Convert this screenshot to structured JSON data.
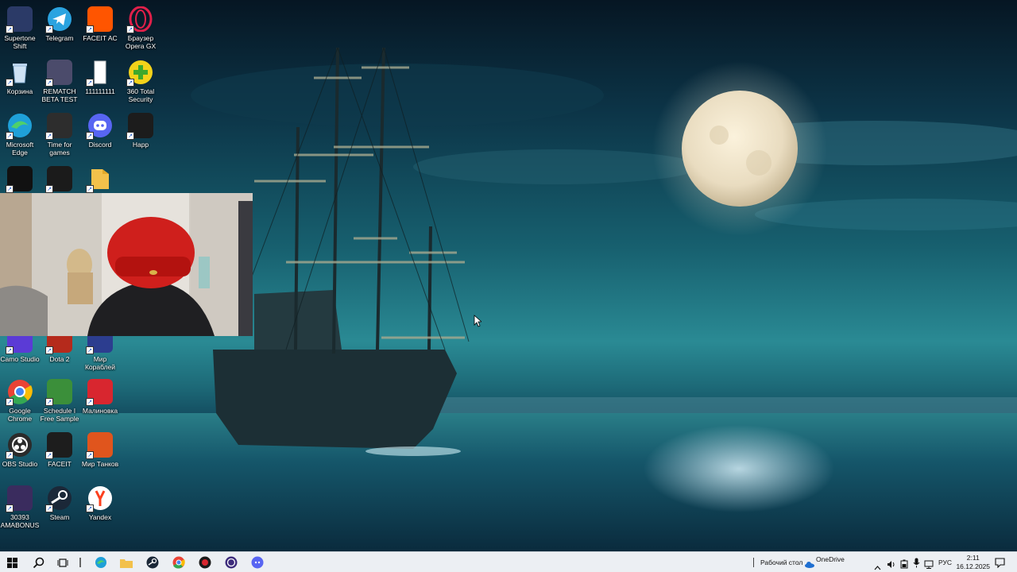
{
  "desktop": {
    "icons": [
      {
        "label": "Supertone Shift",
        "icon": "supertone-icon",
        "color": "#2b3a67"
      },
      {
        "label": "Telegram",
        "icon": "telegram-icon",
        "color": "#2aa3e0"
      },
      {
        "label": "FACEIT AC",
        "icon": "faceit-ac-icon",
        "color": "#ff5500"
      },
      {
        "label": "Браузер Opera GX",
        "icon": "opera-gx-icon",
        "color": "#e1204a"
      },
      {
        "label": "Корзина",
        "icon": "recycle-bin-icon",
        "color": "#9ec6e8"
      },
      {
        "label": "REMATCH BETA TEST",
        "icon": "rematch-icon",
        "color": "#4b4b6b"
      },
      {
        "label": "111111111",
        "icon": "blank-file-icon",
        "color": "#ffffff"
      },
      {
        "label": "360 Total Security",
        "icon": "360-security-icon",
        "color": "#5bbd2b"
      },
      {
        "label": "Microsoft Edge",
        "icon": "edge-icon",
        "color": "#1fa0d8"
      },
      {
        "label": "Time for games",
        "icon": "gamepad-icon",
        "color": "#2d2d2d"
      },
      {
        "label": "Discord",
        "icon": "discord-icon",
        "color": "#5865f2"
      },
      {
        "label": "Happ",
        "icon": "happ-icon",
        "color": "#1c1c1c"
      },
      {
        "label": "",
        "icon": "logitech-g-icon",
        "color": "#111111"
      },
      {
        "label": "",
        "icon": "bear-app-icon",
        "color": "#1b1b1b"
      },
      {
        "label": "",
        "icon": "folder-icon",
        "color": "#f3c14b"
      },
      {
        "label": "Camo Studio",
        "icon": "camo-icon",
        "color": "#5b3bd6"
      },
      {
        "label": "Dota 2",
        "icon": "dota2-icon",
        "color": "#b52a1c"
      },
      {
        "label": "Мир Кораблей",
        "icon": "world-of-ships-icon",
        "color": "#2c3d8f"
      },
      {
        "label": "Google Chrome",
        "icon": "chrome-icon",
        "color": "#34a853"
      },
      {
        "label": "Schedule I Free Sample",
        "icon": "schedule-i-icon",
        "color": "#3b8f3a"
      },
      {
        "label": "Малиновка",
        "icon": "malinovka-icon",
        "color": "#d8262f"
      },
      {
        "label": "OBS Studio",
        "icon": "obs-icon",
        "color": "#2b2b2b"
      },
      {
        "label": "FACEIT",
        "icon": "faceit-icon",
        "color": "#1d1d1d"
      },
      {
        "label": "Мир Танков",
        "icon": "world-of-tanks-icon",
        "color": "#e0551d"
      },
      {
        "label": "30393 AMABONUS",
        "icon": "game-cover-icon",
        "color": "#3a2c5e"
      },
      {
        "label": "Steam",
        "icon": "steam-icon",
        "color": "#1b2838"
      },
      {
        "label": "Yandex",
        "icon": "yandex-icon",
        "color": "#ffffff"
      }
    ]
  },
  "taskbar": {
    "apps": [
      {
        "name": "start-button",
        "icon": "windows-icon"
      },
      {
        "name": "search-button",
        "icon": "search-icon"
      },
      {
        "name": "task-view-button",
        "icon": "task-view-icon"
      },
      {
        "name": "taskbar-edge",
        "icon": "edge-icon"
      },
      {
        "name": "taskbar-explorer",
        "icon": "folder-icon"
      },
      {
        "name": "taskbar-steam",
        "icon": "steam-icon"
      },
      {
        "name": "taskbar-chrome",
        "icon": "chrome-icon"
      },
      {
        "name": "taskbar-app-red",
        "icon": "red-app-icon"
      },
      {
        "name": "taskbar-obs",
        "icon": "obs-icon"
      },
      {
        "name": "taskbar-discord",
        "icon": "discord-icon"
      }
    ],
    "desktop_toolbar": "Рабочий стол",
    "onedrive": "OneDrive",
    "language": "РУС",
    "time": "2:11",
    "date": "16.12.2025"
  }
}
